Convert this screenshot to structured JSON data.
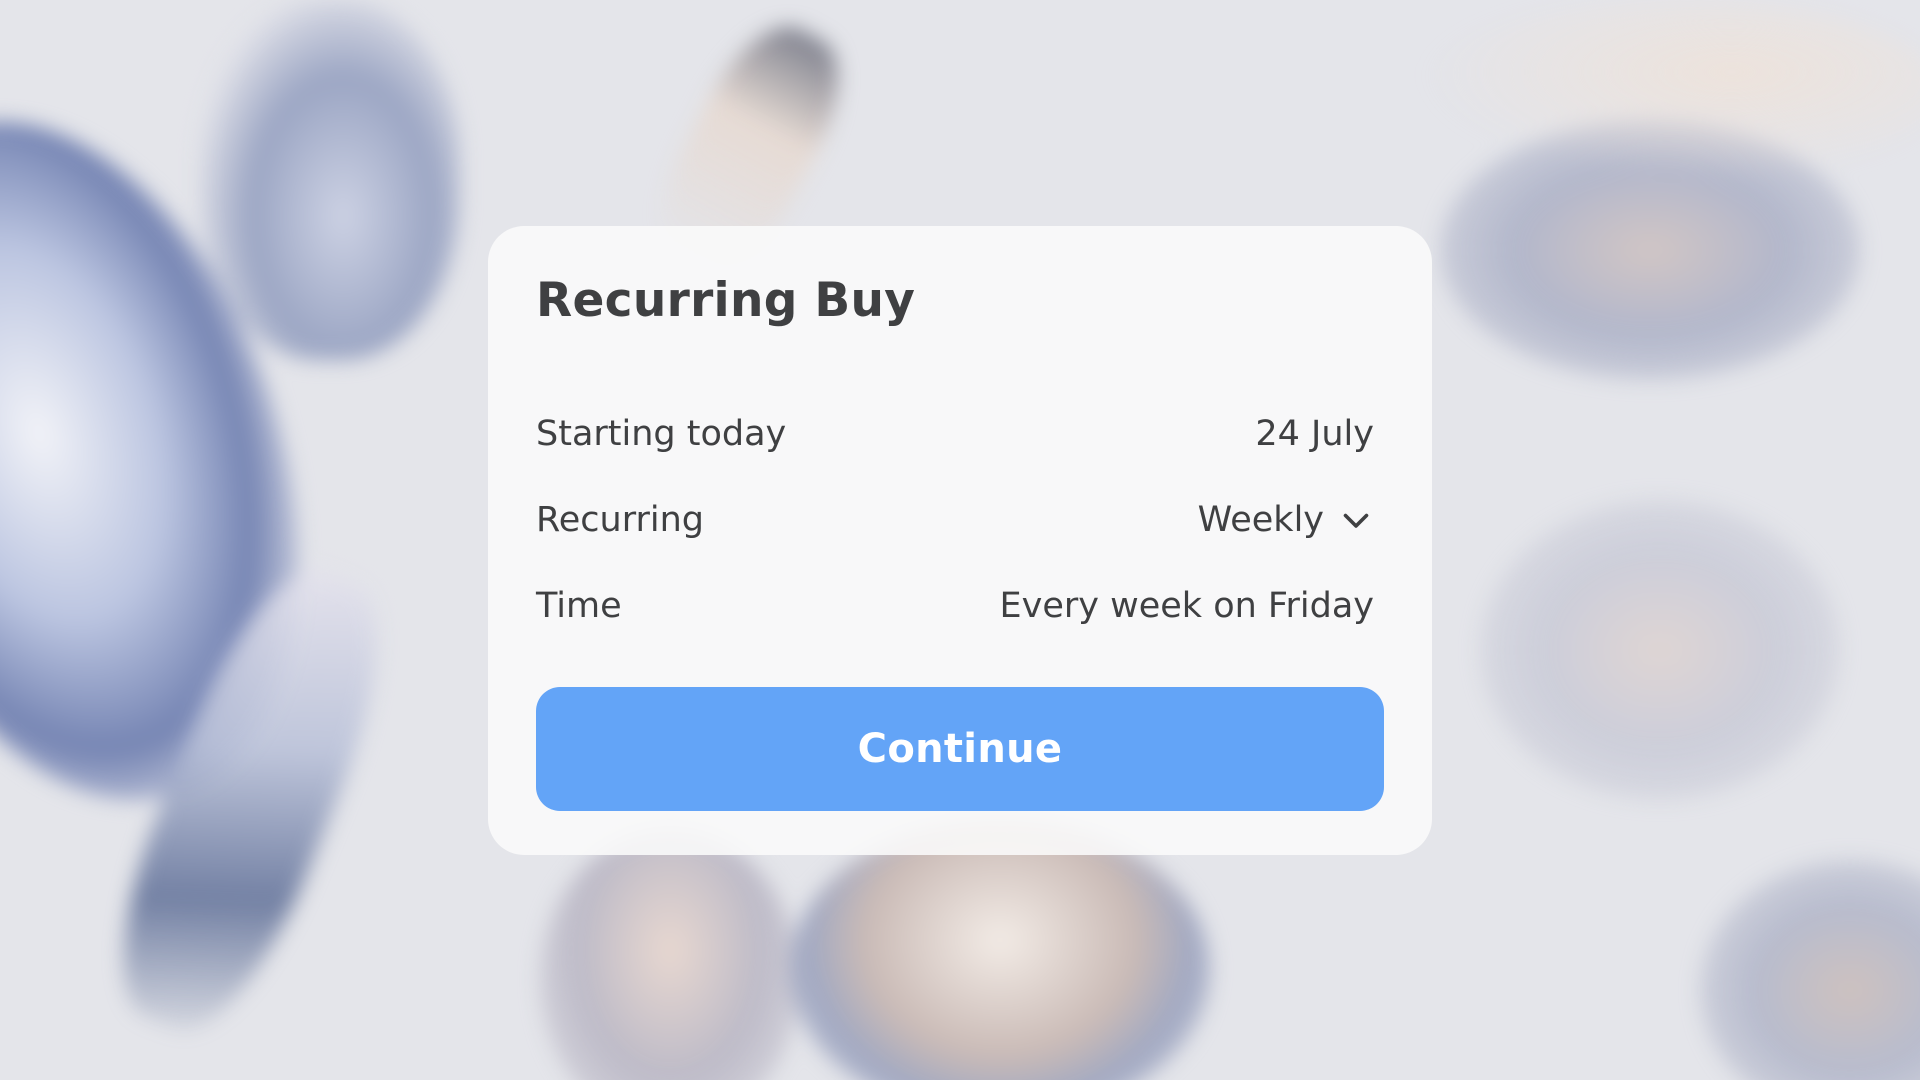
{
  "dialog": {
    "title": "Recurring Buy",
    "rows": [
      {
        "label": "Starting today",
        "value": "24 July"
      },
      {
        "label": "Recurring",
        "value": "Weekly",
        "icon": "chevron-down-icon"
      },
      {
        "label": "Time",
        "value": "Every week on Friday"
      }
    ],
    "continue_label": "Continue"
  },
  "colors": {
    "accent": "#63a4f7",
    "text": "#3f4042",
    "card_background": "#fafbfb",
    "page_background": "#e4e5ea"
  }
}
